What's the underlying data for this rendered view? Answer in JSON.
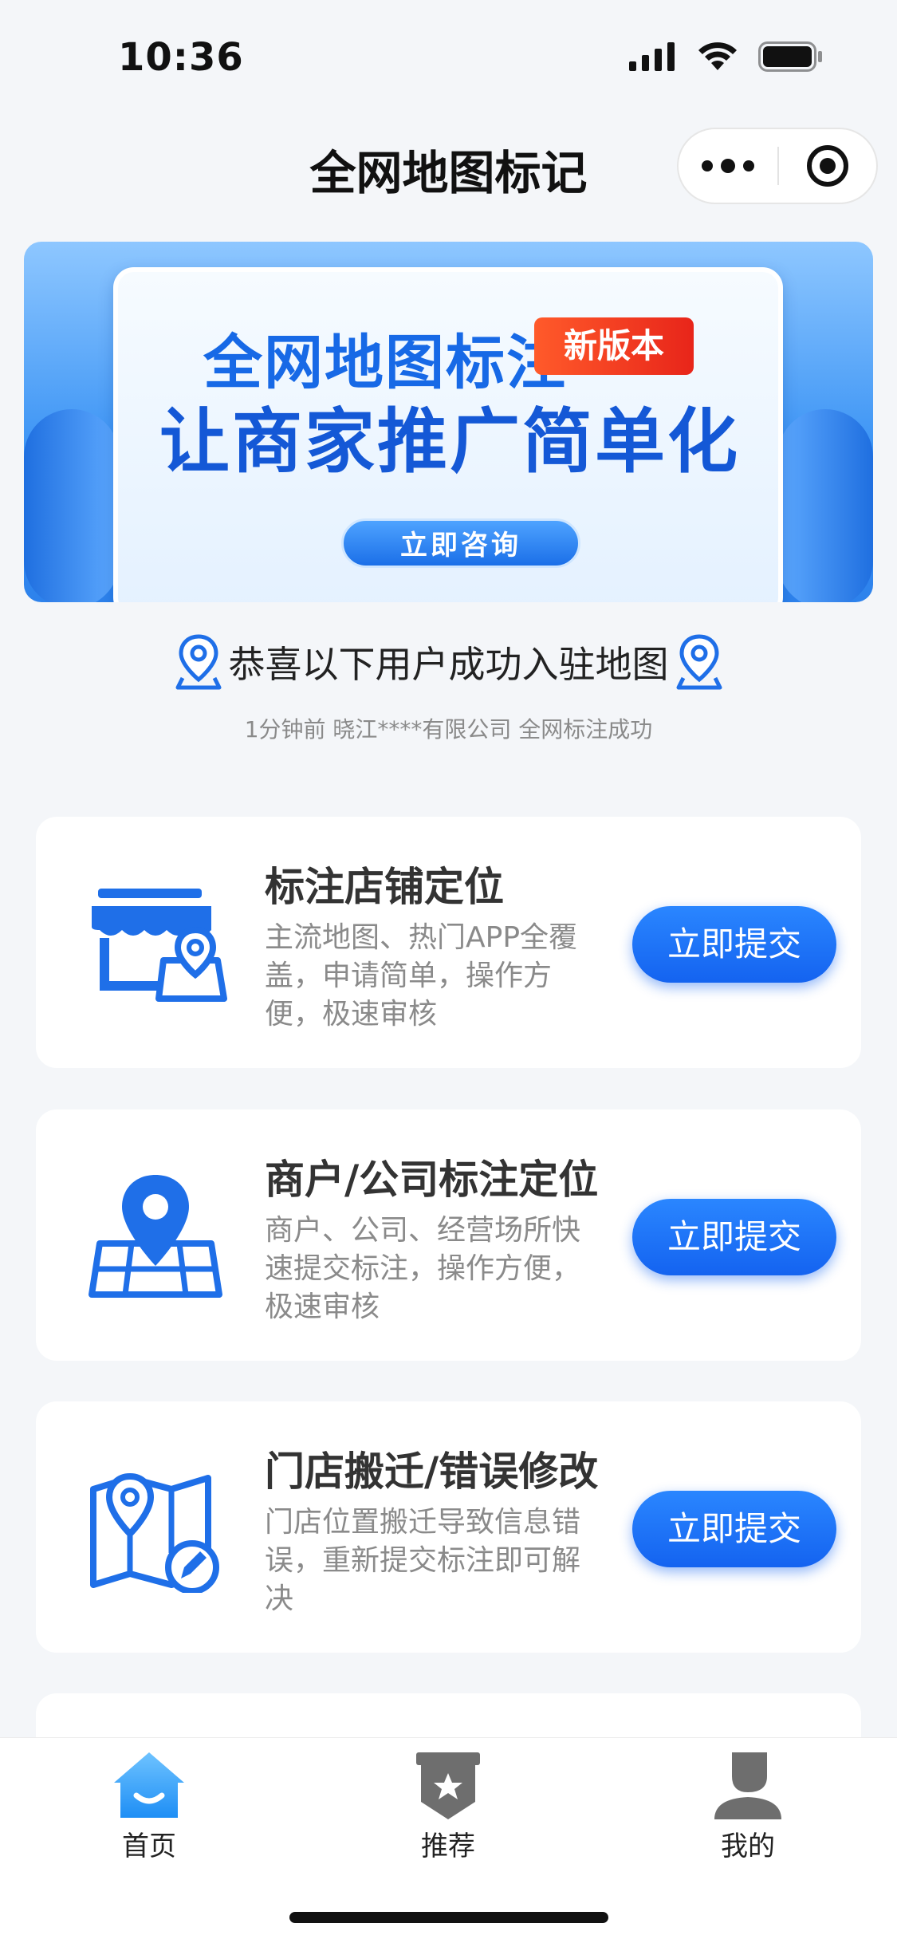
{
  "status_bar": {
    "time": "10:36"
  },
  "nav": {
    "title": "全网地图标记"
  },
  "banner": {
    "headline": "全网地图标注",
    "badge": "新版本",
    "slogan": "让商家推广简单化",
    "cta": "立即咨询"
  },
  "congrats": {
    "text": "恭喜以下用户成功入驻地图",
    "ticker": "1分钟前 晓江****有限公司 全网标注成功"
  },
  "services": [
    {
      "title": "标注店铺定位",
      "description": "主流地图、热门APP全覆盖，申请简单，操作方便，极速审核",
      "button": "立即提交",
      "icon": "storefront-map-pin-icon"
    },
    {
      "title": "商户/公司标注定位",
      "description": "商户、公司、经营场所快速提交标注，操作方便，极速审核",
      "button": "立即提交",
      "icon": "map-pin-icon"
    },
    {
      "title": "门店搬迁/错误修改",
      "description": "门店位置搬迁导致信息错误，重新提交标注即可解决",
      "button": "立即提交",
      "icon": "map-edit-icon"
    }
  ],
  "tabs": [
    {
      "label": "首页",
      "icon": "home-icon",
      "active": true
    },
    {
      "label": "推荐",
      "icon": "star-badge-icon",
      "active": false
    },
    {
      "label": "我的",
      "icon": "user-icon",
      "active": false
    }
  ],
  "colors": {
    "primary": "#1463f0",
    "accent_red": "#e8251a",
    "text_secondary": "#8a8a8a"
  }
}
